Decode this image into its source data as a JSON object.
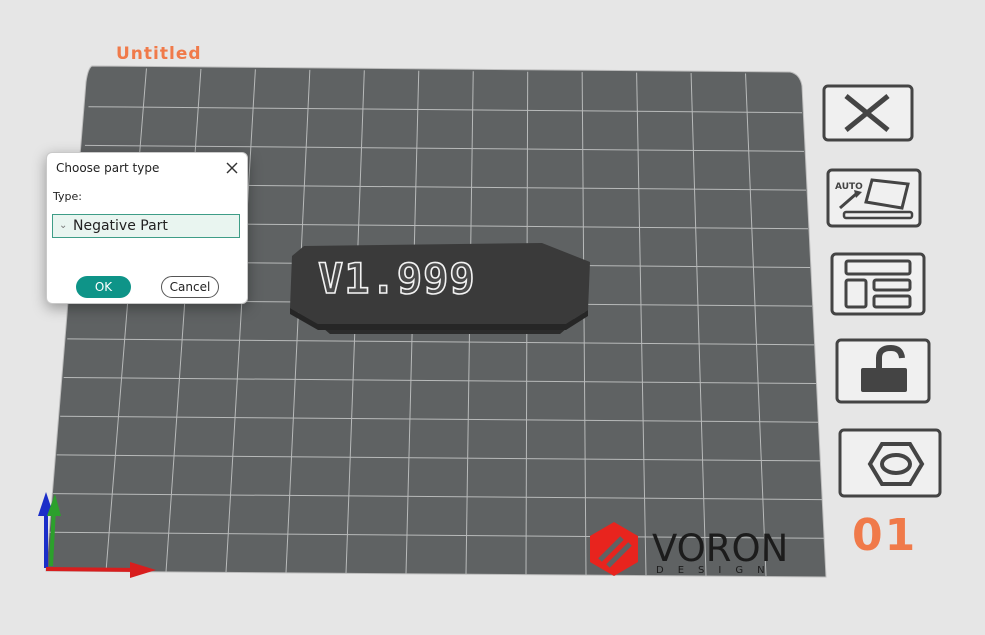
{
  "project": {
    "title": "Untitled"
  },
  "model": {
    "label": "V1.999"
  },
  "dialog": {
    "title": "Choose part type",
    "type_label": "Type:",
    "selected_type": "Negative Part",
    "ok_label": "OK",
    "cancel_label": "Cancel"
  },
  "toolbar": {
    "tools": [
      {
        "name": "delete-plate",
        "icon": "close-icon"
      },
      {
        "name": "auto-orient",
        "icon": "auto-orient-icon",
        "label": "AUTO"
      },
      {
        "name": "arrange",
        "icon": "arrange-icon"
      },
      {
        "name": "lock",
        "icon": "unlock-icon"
      },
      {
        "name": "plate-settings",
        "icon": "hex-nut-icon"
      }
    ],
    "plate_index": "01"
  },
  "brand": {
    "name": "VORON",
    "sub": "DESIGN"
  },
  "colors": {
    "accent": "#f07a4a",
    "bed": "#5f6263",
    "grid": "#b4b6b6",
    "teal": "#0e9488"
  }
}
